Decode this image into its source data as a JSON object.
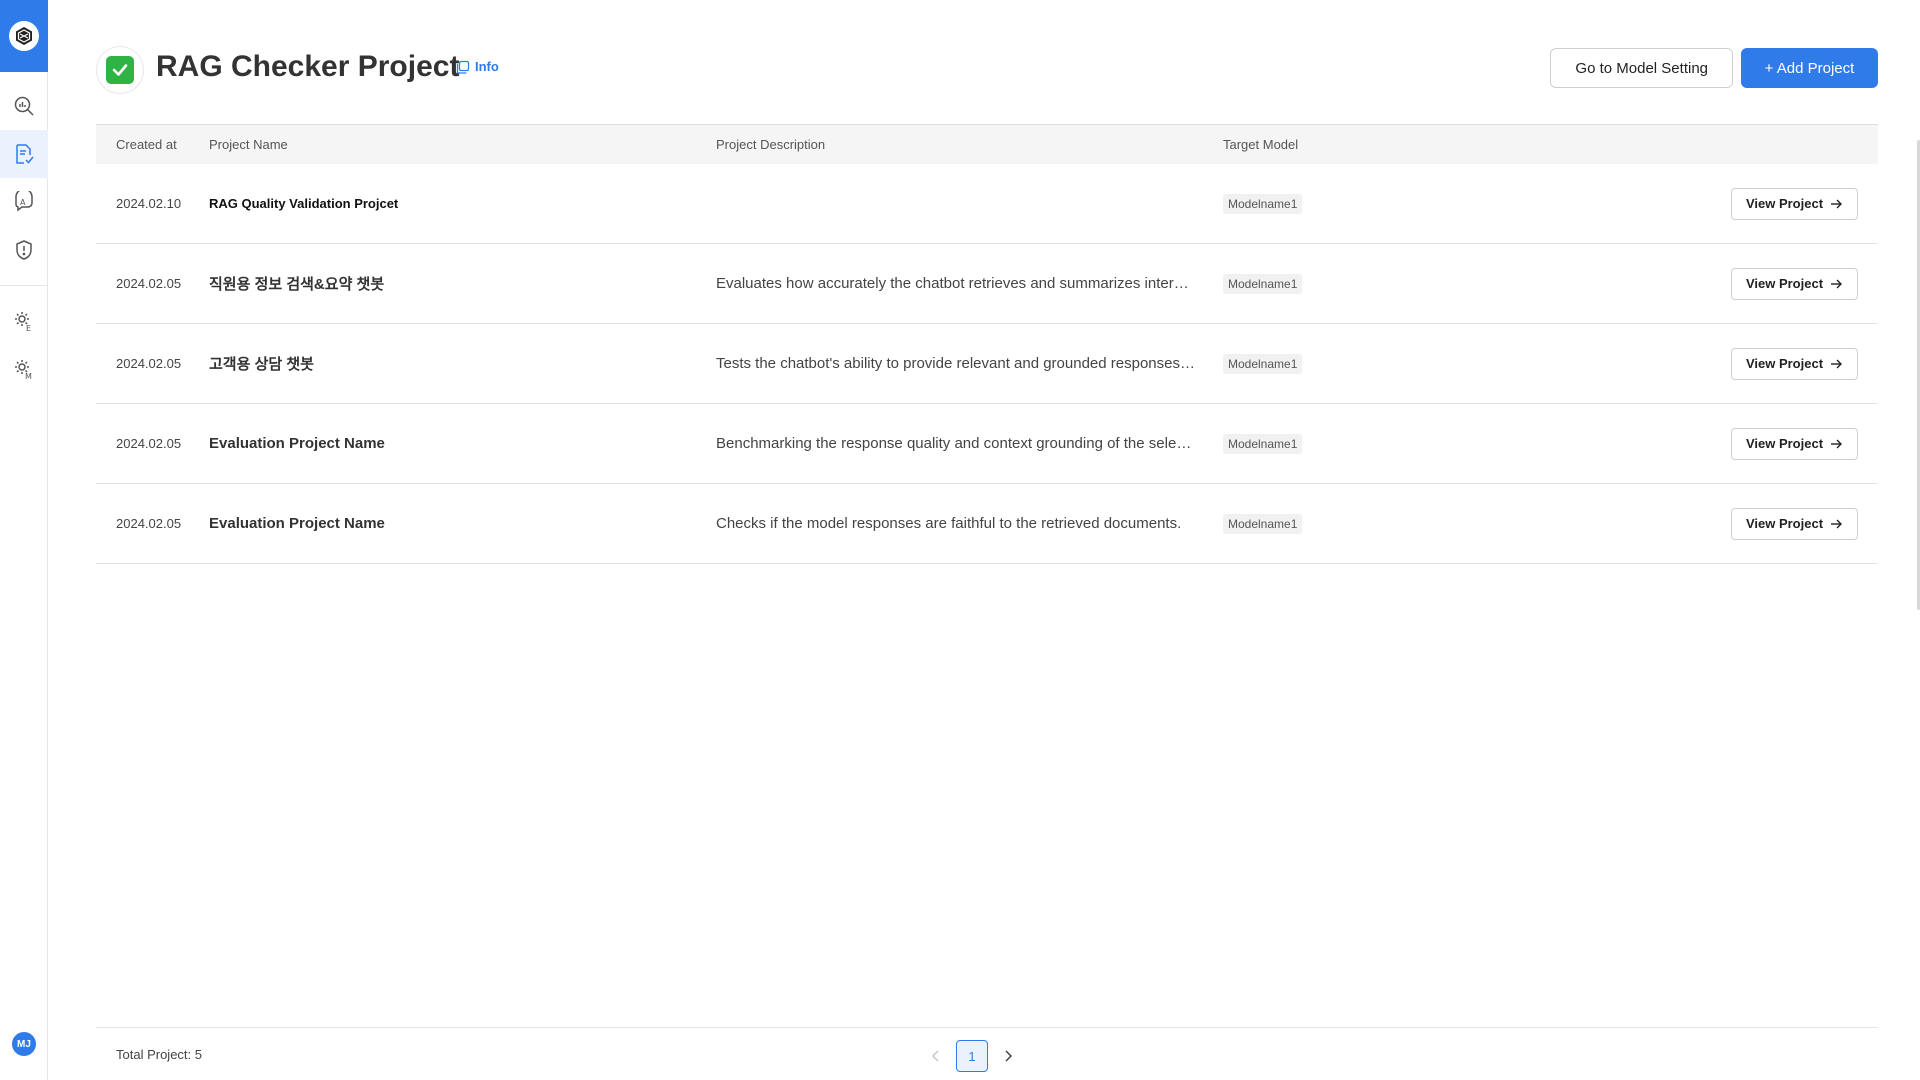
{
  "colors": {
    "primary": "#2f7bea",
    "check": "#2fb344",
    "border": "#e3e3e3"
  },
  "sidebar": {
    "logo": "hex-logo-icon",
    "avatar_initials": "MJ",
    "items": [
      {
        "icon": "analytics-search-icon",
        "active": false
      },
      {
        "icon": "document-check-icon",
        "active": true
      },
      {
        "icon": "translate-icon",
        "active": false
      },
      {
        "icon": "shield-alert-icon",
        "active": false
      },
      {
        "icon": "settings-e-icon",
        "active": false
      },
      {
        "icon": "settings-m-icon",
        "active": false
      }
    ]
  },
  "header": {
    "title": "RAG Checker Project",
    "info_label": "Info",
    "model_setting_label": "Go to Model Setting",
    "add_project_label": "+ Add Project"
  },
  "table": {
    "columns": [
      "Created at",
      "Project Name",
      "Project Description",
      "Target Model",
      ""
    ],
    "rows": [
      {
        "created_at": "2024.02.10",
        "name": "RAG Quality Validation Projcet",
        "description": "",
        "model": "Modelname1",
        "action": "View Project"
      },
      {
        "created_at": "2024.02.05",
        "name": "직원용 정보 검색&요약 챗봇",
        "description": "Evaluates how accurately the chatbot retrieves and summarizes internal documents for employees.",
        "model": "Modelname1",
        "action": "View Project"
      },
      {
        "created_at": "2024.02.05",
        "name": "고객용 상담 챗봇",
        "description": "Tests the chatbot's ability to provide relevant and grounded responses to customer inquiries.",
        "model": "Modelname1",
        "action": "View Project"
      },
      {
        "created_at": "2024.02.05",
        "name": "Evaluation Project Name",
        "description": "Benchmarking the response quality and context grounding of the selected model.",
        "model": "Modelname1",
        "action": "View Project"
      },
      {
        "created_at": "2024.02.05",
        "name": "Evaluation Project Name",
        "description": "Checks if the model responses are faithful to the retrieved documents.",
        "model": "Modelname1",
        "action": "View Project"
      }
    ]
  },
  "footer": {
    "total_label": "Total Project: 5",
    "current_page": "1"
  }
}
